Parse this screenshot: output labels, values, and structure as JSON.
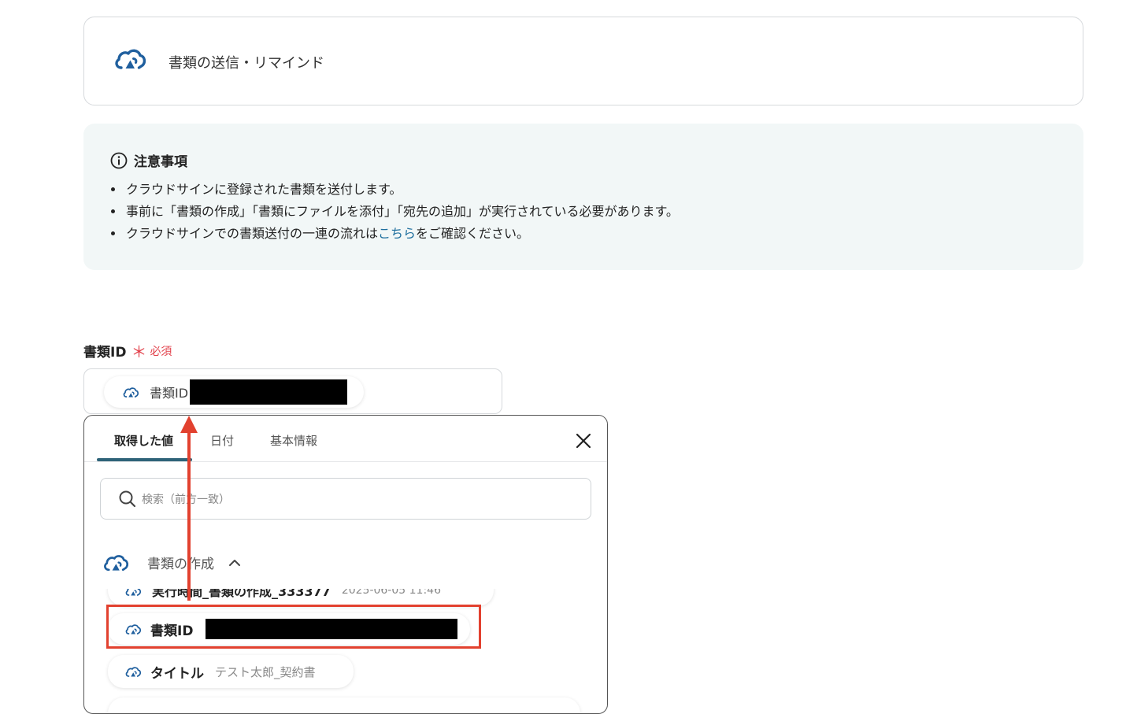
{
  "action_card": {
    "title": "書類の送信・リマインド",
    "icon": "cloudsign-logo-icon"
  },
  "notice": {
    "title": "注意事項",
    "items": [
      "クラウドサインに登録された書類を送付します。",
      "事前に「書類の作成」「書類にファイルを添付」「宛先の追加」が実行されている必要があります。"
    ],
    "item3_before": "クラウドサインでの書類送付の一連の流れは",
    "item3_link": "こちら",
    "item3_after": "をご確認ください。"
  },
  "field": {
    "label": "書類ID",
    "required_mark": "＊",
    "required_text": "必須",
    "chip_label": "書類ID"
  },
  "panel": {
    "tabs": [
      {
        "label": "取得した値",
        "active": true
      },
      {
        "label": "日付",
        "active": false
      },
      {
        "label": "基本情報",
        "active": false
      }
    ],
    "search_placeholder": "検索（前方一致）",
    "group_title": "書類の作成",
    "rows": [
      {
        "label": "実行時間_書類の作成_333377",
        "value": "2025-06-05 11:46"
      },
      {
        "label": "書類ID",
        "value": ""
      },
      {
        "label": "タイトル",
        "value": "テスト太郎_契約書"
      }
    ]
  },
  "colors": {
    "accent": "#1f5f9e",
    "required": "#e2414b",
    "highlight": "#e2412f",
    "tab_underline": "#2e6379"
  }
}
